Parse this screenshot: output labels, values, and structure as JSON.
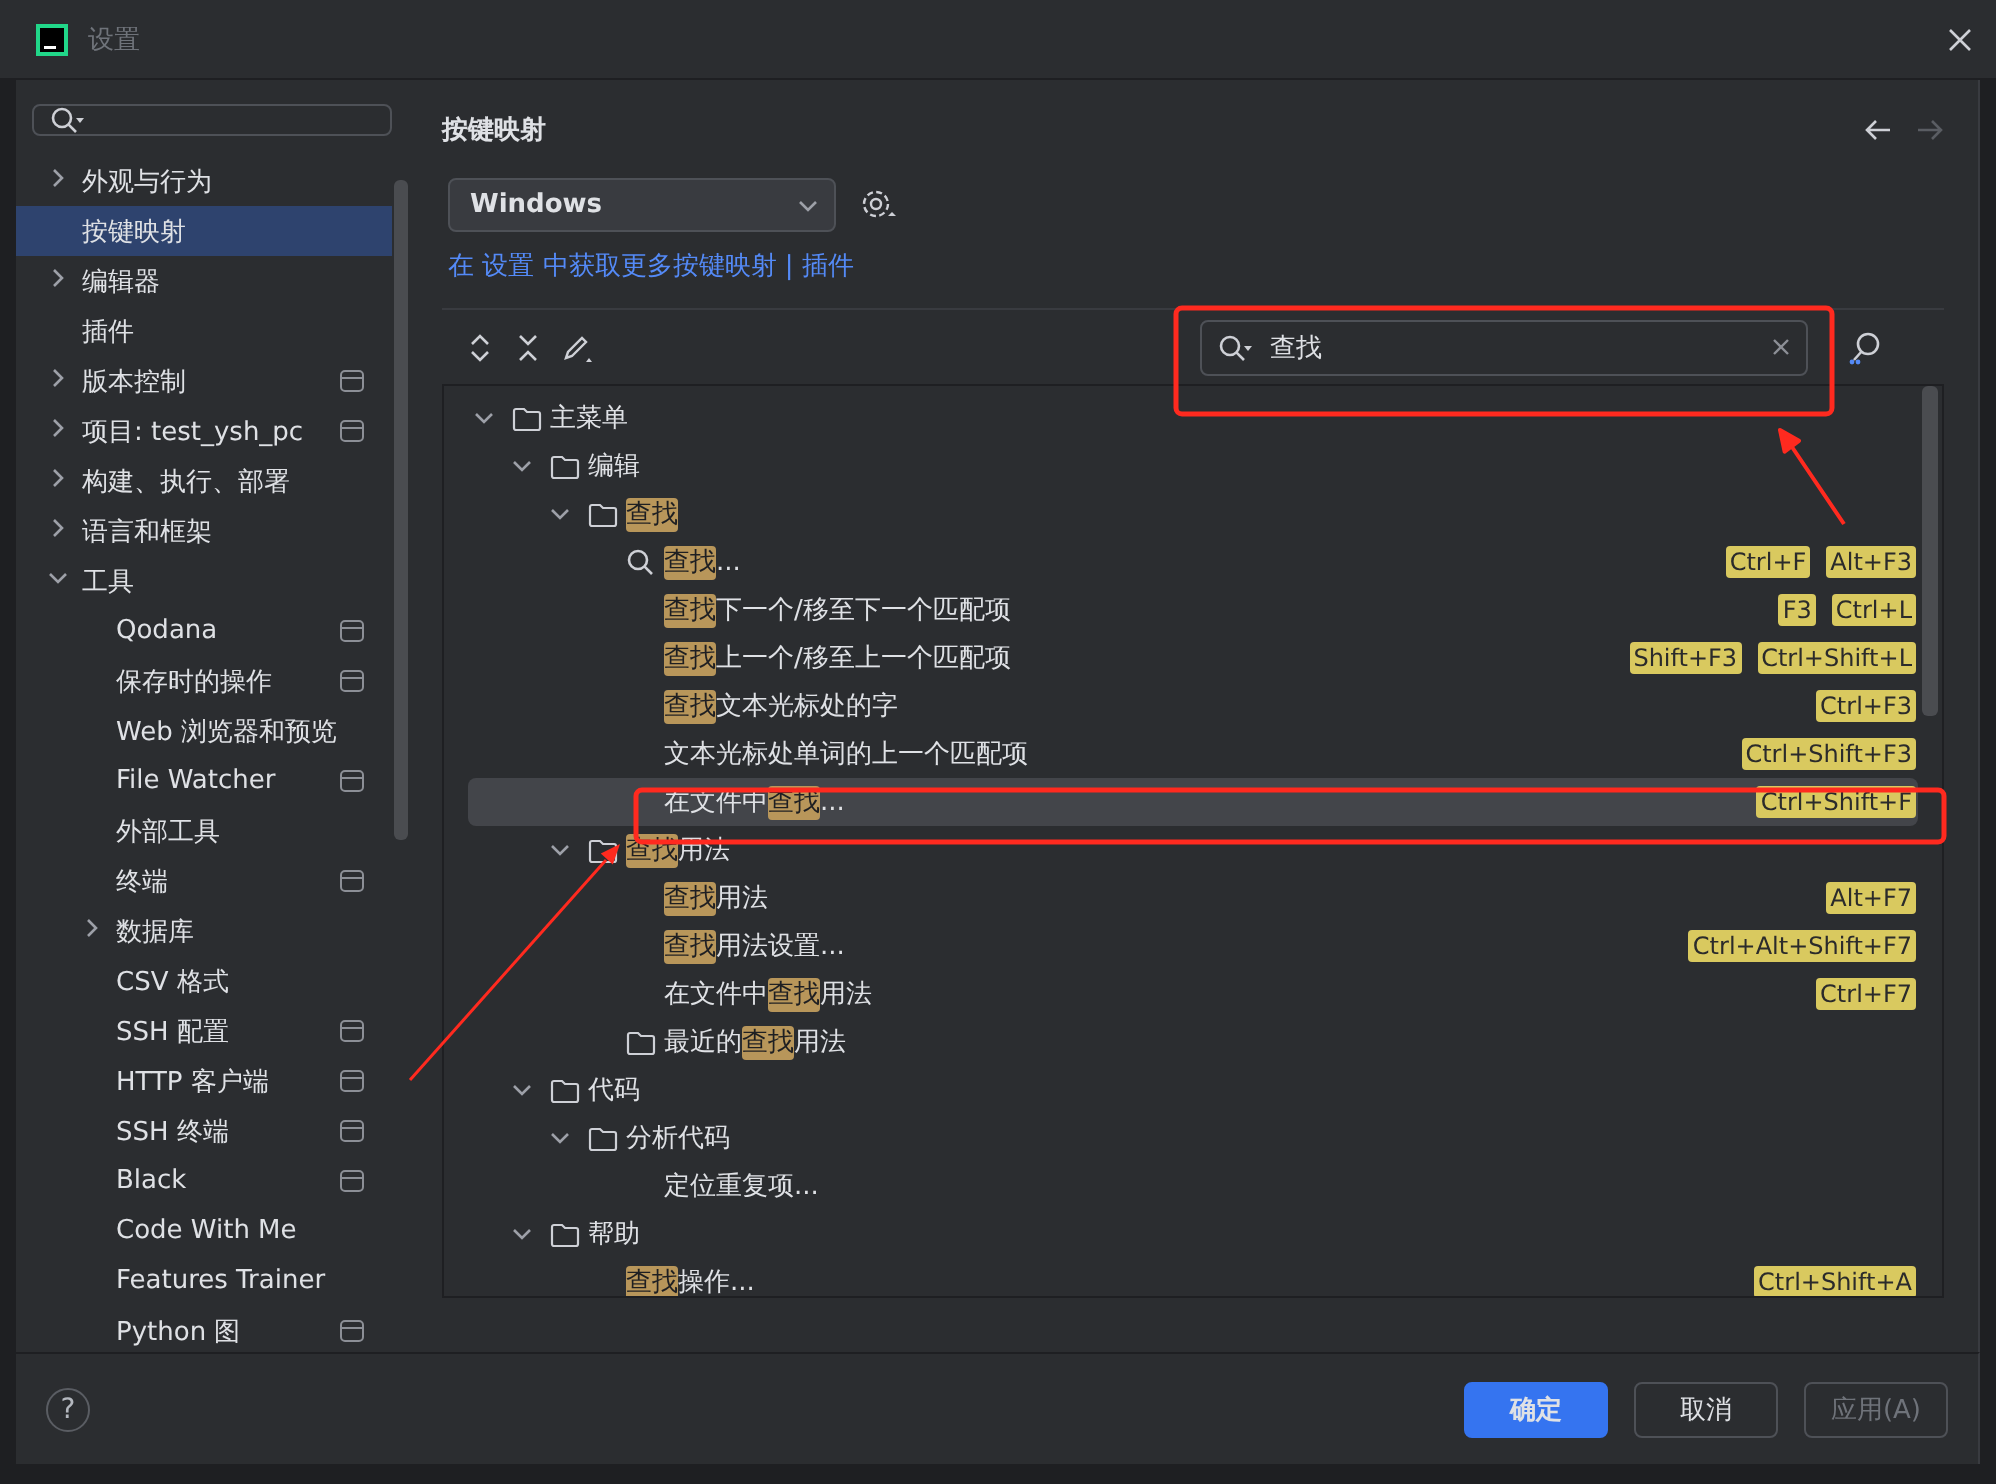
{
  "window": {
    "title": "设置"
  },
  "sidebar": {
    "items": [
      {
        "label": "外观与行为",
        "expanded": false,
        "selected": false,
        "scoped": false
      },
      {
        "label": "按键映射",
        "selected": true,
        "scoped": false
      },
      {
        "label": "编辑器",
        "expanded": false,
        "selected": false,
        "scoped": false
      },
      {
        "label": "插件",
        "selected": false,
        "scoped": false
      },
      {
        "label": "版本控制",
        "expanded": false,
        "selected": false,
        "scoped": true
      },
      {
        "label": "项目: test_ysh_pc",
        "expanded": false,
        "selected": false,
        "scoped": true
      },
      {
        "label": "构建、执行、部署",
        "expanded": false,
        "selected": false,
        "scoped": false
      },
      {
        "label": "语言和框架",
        "expanded": false,
        "selected": false,
        "scoped": false
      },
      {
        "label": "工具",
        "expanded": true,
        "selected": false,
        "scoped": false,
        "children": [
          {
            "label": "Qodana",
            "selected": false,
            "scoped": true
          },
          {
            "label": "保存时的操作",
            "selected": false,
            "scoped": true
          },
          {
            "label": "Web 浏览器和预览",
            "selected": false,
            "scoped": false
          },
          {
            "label": "File Watcher",
            "selected": false,
            "scoped": true
          },
          {
            "label": "外部工具",
            "selected": false,
            "scoped": false
          },
          {
            "label": "终端",
            "selected": false,
            "scoped": true
          },
          {
            "label": "数据库",
            "expanded": false,
            "selected": false,
            "scoped": false
          },
          {
            "label": "CSV 格式",
            "selected": false,
            "scoped": false
          },
          {
            "label": "SSH 配置",
            "selected": false,
            "scoped": true
          },
          {
            "label": "HTTP 客户端",
            "selected": false,
            "scoped": true
          },
          {
            "label": "SSH 终端",
            "selected": false,
            "scoped": true
          },
          {
            "label": "Black",
            "selected": false,
            "scoped": true
          },
          {
            "label": "Code With Me",
            "selected": false,
            "scoped": false
          },
          {
            "label": "Features Trainer",
            "selected": false,
            "scoped": false
          },
          {
            "label": "Python 图",
            "selected": false,
            "scoped": true
          }
        ]
      }
    ]
  },
  "page": {
    "title": "按键映射",
    "keymap": {
      "value": "Windows"
    },
    "link_text": {
      "prefix": "在 ",
      "link1": "设置",
      "middle": " 中获取更多按键映射 | ",
      "link2": "插件"
    },
    "search": {
      "value": "查找"
    },
    "tree": [
      {
        "kind": "folder",
        "expanded": true,
        "selected": false,
        "label": [
          {
            "text": "主菜单",
            "match": false
          }
        ],
        "children": [
          {
            "kind": "folder",
            "expanded": true,
            "selected": false,
            "label": [
              {
                "text": "编辑",
                "match": false
              }
            ],
            "children": [
              {
                "kind": "folder",
                "expanded": true,
                "selected": false,
                "label": [
                  {
                    "text": "查找",
                    "match": true
                  }
                ],
                "children": [
                  {
                    "kind": "search-action",
                    "selected": false,
                    "label": [
                      {
                        "text": "查找",
                        "match": true
                      },
                      {
                        "text": "...",
                        "match": false
                      }
                    ],
                    "shortcuts": [
                      "Ctrl+F",
                      "Alt+F3"
                    ]
                  },
                  {
                    "kind": "action",
                    "selected": false,
                    "label": [
                      {
                        "text": "查找",
                        "match": true
                      },
                      {
                        "text": "下一个/移至下一个匹配项",
                        "match": false
                      }
                    ],
                    "shortcuts": [
                      "F3",
                      "Ctrl+L"
                    ]
                  },
                  {
                    "kind": "action",
                    "selected": false,
                    "label": [
                      {
                        "text": "查找",
                        "match": true
                      },
                      {
                        "text": "上一个/移至上一个匹配项",
                        "match": false
                      }
                    ],
                    "shortcuts": [
                      "Shift+F3",
                      "Ctrl+Shift+L"
                    ]
                  },
                  {
                    "kind": "action",
                    "selected": false,
                    "label": [
                      {
                        "text": "查找",
                        "match": true
                      },
                      {
                        "text": "文本光标处的字",
                        "match": false
                      }
                    ],
                    "shortcuts": [
                      "Ctrl+F3"
                    ]
                  },
                  {
                    "kind": "action",
                    "selected": false,
                    "label": [
                      {
                        "text": "文本光标处单词的上一个匹配项",
                        "match": false
                      }
                    ],
                    "shortcuts": [
                      "Ctrl+Shift+F3"
                    ]
                  },
                  {
                    "kind": "action",
                    "selected": true,
                    "label": [
                      {
                        "text": "在文件中",
                        "match": false
                      },
                      {
                        "text": "查找",
                        "match": true
                      },
                      {
                        "text": "...",
                        "match": false
                      }
                    ],
                    "shortcuts": [
                      "Ctrl+Shift+F"
                    ]
                  }
                ]
              },
              {
                "kind": "folder",
                "expanded": true,
                "selected": false,
                "label": [
                  {
                    "text": "查找",
                    "match": true
                  },
                  {
                    "text": "用法",
                    "match": false
                  }
                ],
                "children": [
                  {
                    "kind": "action",
                    "selected": false,
                    "label": [
                      {
                        "text": "查找",
                        "match": true
                      },
                      {
                        "text": "用法",
                        "match": false
                      }
                    ],
                    "shortcuts": [
                      "Alt+F7"
                    ]
                  },
                  {
                    "kind": "action",
                    "selected": false,
                    "label": [
                      {
                        "text": "查找",
                        "match": true
                      },
                      {
                        "text": "用法设置...",
                        "match": false
                      }
                    ],
                    "shortcuts": [
                      "Ctrl+Alt+Shift+F7"
                    ]
                  },
                  {
                    "kind": "action",
                    "selected": false,
                    "label": [
                      {
                        "text": "在文件中",
                        "match": false
                      },
                      {
                        "text": "查找",
                        "match": true
                      },
                      {
                        "text": "用法",
                        "match": false
                      }
                    ],
                    "shortcuts": [
                      "Ctrl+F7"
                    ]
                  },
                  {
                    "kind": "folder",
                    "selected": false,
                    "label": [
                      {
                        "text": "最近的",
                        "match": false
                      },
                      {
                        "text": "查找",
                        "match": true
                      },
                      {
                        "text": "用法",
                        "match": false
                      }
                    ]
                  }
                ]
              }
            ]
          },
          {
            "kind": "folder",
            "expanded": true,
            "selected": false,
            "label": [
              {
                "text": "代码",
                "match": false
              }
            ],
            "children": [
              {
                "kind": "folder",
                "expanded": true,
                "selected": false,
                "label": [
                  {
                    "text": "分析代码",
                    "match": false
                  }
                ],
                "children": [
                  {
                    "kind": "action",
                    "selected": false,
                    "label": [
                      {
                        "text": "定位重复项...",
                        "match": false
                      }
                    ]
                  }
                ]
              }
            ]
          },
          {
            "kind": "folder",
            "expanded": true,
            "selected": false,
            "label": [
              {
                "text": "帮助",
                "match": false
              }
            ],
            "children": [
              {
                "kind": "action",
                "selected": false,
                "label": [
                  {
                    "text": "查找",
                    "match": true
                  },
                  {
                    "text": "操作...",
                    "match": false
                  }
                ],
                "shortcuts": [
                  "Ctrl+Shift+A"
                ]
              }
            ]
          }
        ]
      }
    ]
  },
  "footer": {
    "help": "?",
    "buttons": [
      {
        "label": "确定",
        "kind": "primary",
        "disabled": false
      },
      {
        "label": "取消",
        "kind": "secondary",
        "disabled": false
      },
      {
        "label": "应用(A)",
        "kind": "secondary",
        "disabled": true
      }
    ]
  }
}
